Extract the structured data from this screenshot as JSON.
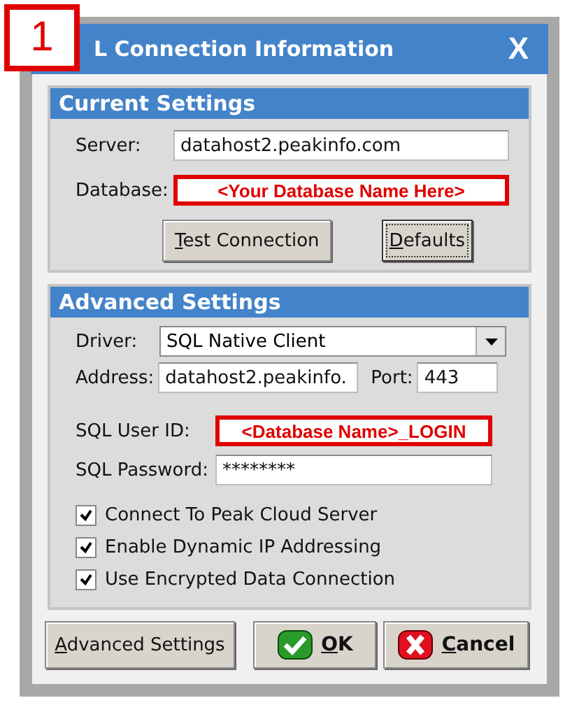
{
  "step_badge": "1",
  "window": {
    "title": "L Connection Information",
    "close": "X"
  },
  "current_settings": {
    "title": "Current Settings",
    "fields": [
      {
        "label": "Server:",
        "value": "datahost2.peakinfo.com",
        "highlighted": false
      },
      {
        "label": "Database:",
        "value": "<Your Database Name Here>",
        "highlighted": true
      }
    ],
    "buttons": [
      {
        "key": "T",
        "rest": "est Connection",
        "default": false
      },
      {
        "key": "D",
        "rest": "efaults",
        "default": true
      }
    ]
  },
  "advanced_settings": {
    "title": "Advanced Settings",
    "driver": {
      "label": "Driver:",
      "value": "SQL Native Client"
    },
    "address": {
      "label": "Address:",
      "value": "datahost2.peakinfo."
    },
    "port": {
      "label": "Port:",
      "value": "443"
    },
    "fields": [
      {
        "label": "SQL User ID:",
        "value": "<Database Name>_LOGIN",
        "highlighted": true
      },
      {
        "label": "SQL Password:",
        "value": "********",
        "highlighted": false
      }
    ],
    "checkboxes": [
      {
        "label": "Connect To Peak Cloud Server",
        "checked": true
      },
      {
        "label": "Enable Dynamic IP Addressing",
        "checked": true
      },
      {
        "label": "Use Encrypted Data Connection",
        "checked": true
      }
    ]
  },
  "footer_buttons": [
    {
      "kind": "plain",
      "key": "A",
      "rest": "dvanced Settings"
    },
    {
      "kind": "ok",
      "key": "O",
      "rest": "K"
    },
    {
      "kind": "cancel",
      "key": "C",
      "rest": "ancel"
    }
  ]
}
